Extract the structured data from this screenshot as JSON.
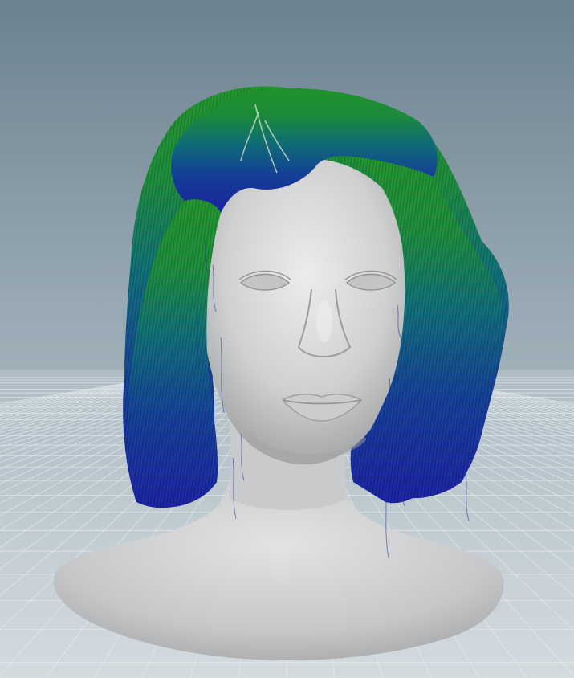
{
  "viewport": {
    "kind": "3d-viewport",
    "background_top_color": "#6f8592",
    "background_bottom_color": "#c4ced3",
    "grid_color": "#e6ecef"
  },
  "scene": {
    "subject": "head-bust",
    "skin_color": "#d2d3d4",
    "hair_root_color": "#1f8a2a",
    "hair_mid_color": "#126e7a",
    "hair_tip_color": "#1d2aa3"
  }
}
